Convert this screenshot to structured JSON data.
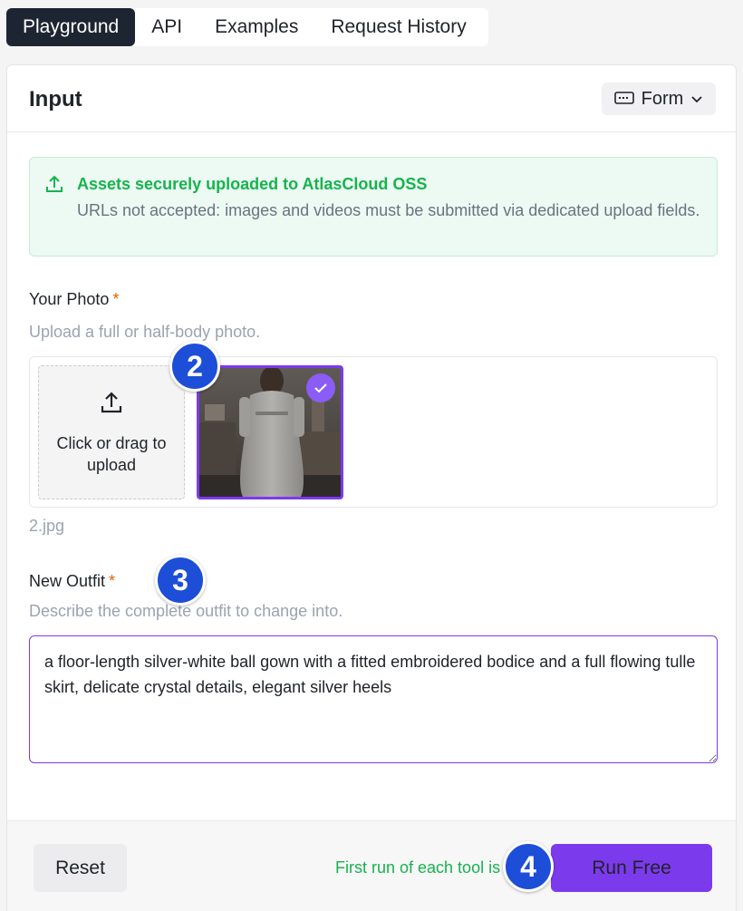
{
  "tabs": [
    {
      "label": "Playground",
      "active": true
    },
    {
      "label": "API",
      "active": false
    },
    {
      "label": "Examples",
      "active": false
    },
    {
      "label": "Request History",
      "active": false
    }
  ],
  "card": {
    "title": "Input",
    "mode_toggle": {
      "label": "Form",
      "icon": "keyboard-icon"
    }
  },
  "notice": {
    "title": "Assets securely uploaded to AtlasCloud OSS",
    "text": "URLs not accepted: images and videos must be submitted via dedicated upload fields."
  },
  "photo_field": {
    "label": "Your Photo",
    "required_mark": "*",
    "help": "Upload a full or half-body photo.",
    "dropzone_label": "Click or drag to upload",
    "filename": "2.jpg"
  },
  "outfit_field": {
    "label": "New Outfit",
    "required_mark": "*",
    "help": "Describe the complete outfit to change into.",
    "value": "a floor-length silver-white ball gown with a fitted embroidered bodice and a full flowing tulle skirt, delicate crystal details, elegant silver heels"
  },
  "footer": {
    "reset_label": "Reset",
    "note": "First run of each tool is",
    "run_label": "Run Free"
  },
  "step_badges": [
    "2",
    "3",
    "4"
  ],
  "colors": {
    "accent": "#7c3aed",
    "success": "#16b34d",
    "badge": "#1d4ed8",
    "tab_active": "#1e2532"
  }
}
